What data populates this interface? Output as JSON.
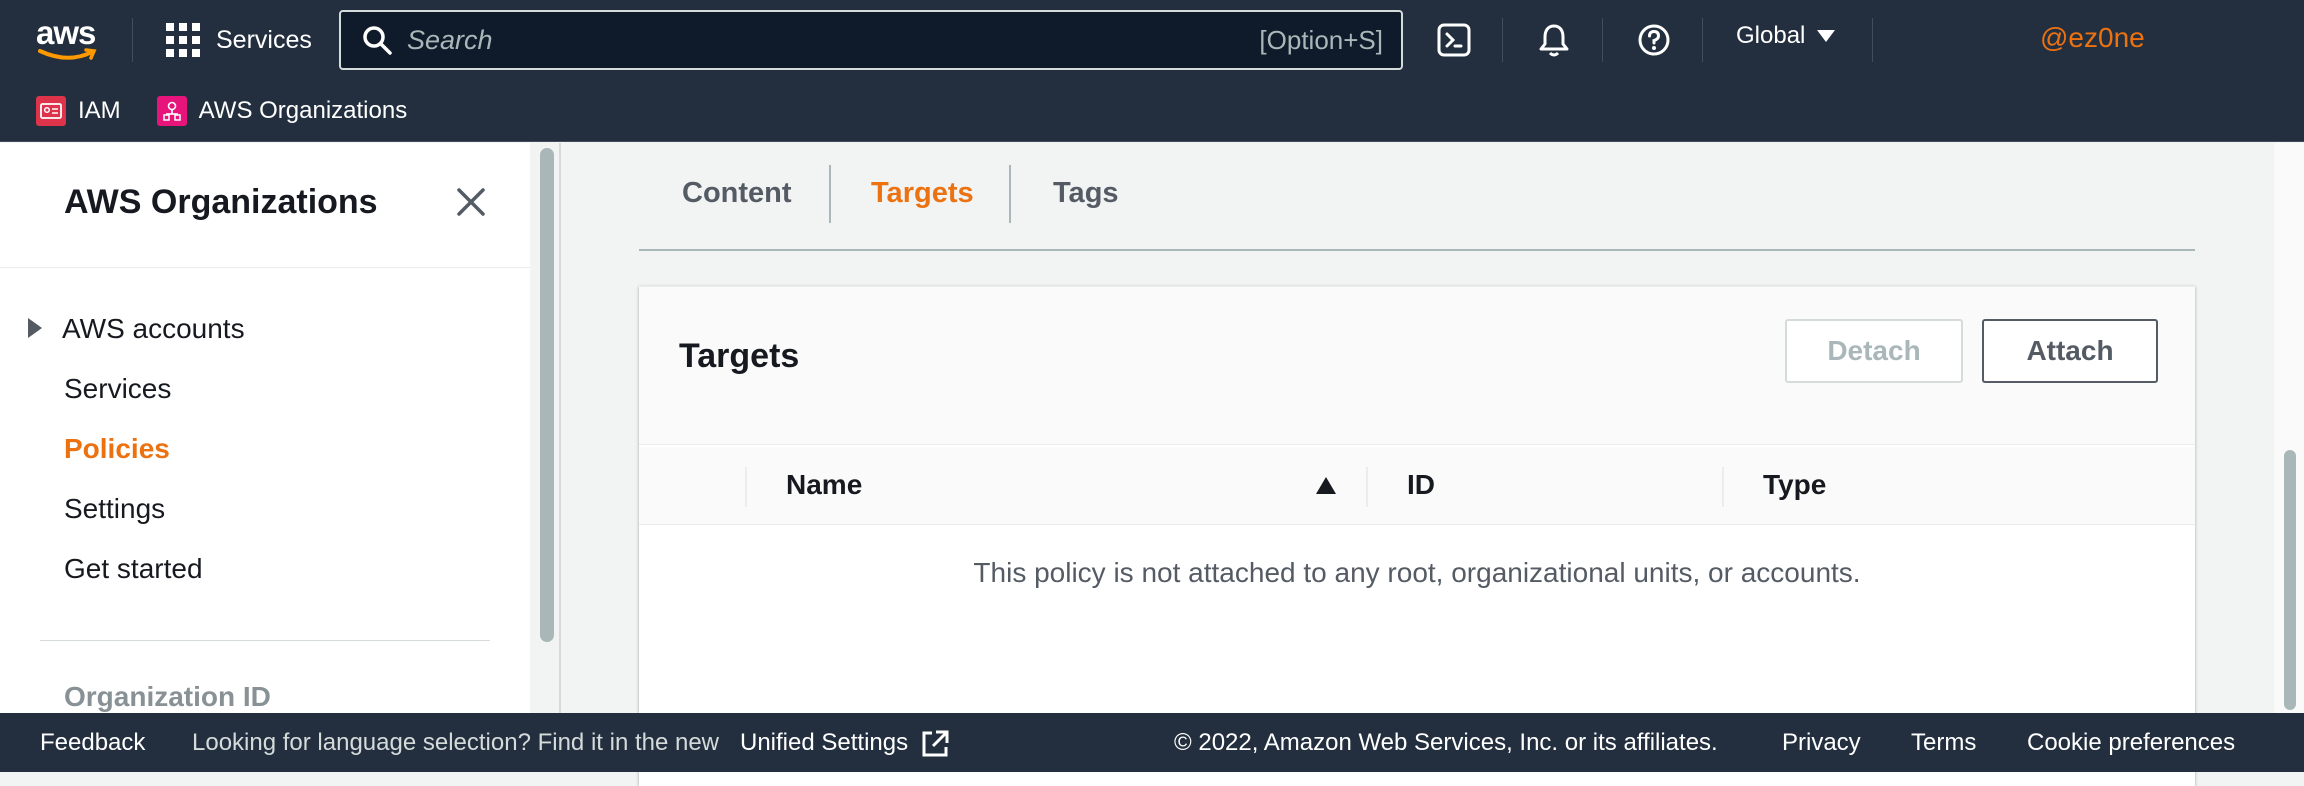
{
  "topbar": {
    "logo_text": "aws",
    "services_label": "Services",
    "search_placeholder": "Search",
    "search_shortcut": "[Option+S]",
    "region_label": "Global",
    "account_label": "@ez0ne",
    "icons": [
      "cloudshell-icon",
      "bell-icon",
      "help-icon"
    ]
  },
  "favorites": [
    {
      "label": "IAM",
      "color": "#dd344c"
    },
    {
      "label": "AWS Organizations",
      "color": "#e7157b"
    }
  ],
  "sidebar": {
    "title": "AWS Organizations",
    "items": [
      {
        "label": "AWS accounts",
        "expandable": true,
        "active": false
      },
      {
        "label": "Services",
        "active": false
      },
      {
        "label": "Policies",
        "active": true
      },
      {
        "label": "Settings",
        "active": false
      },
      {
        "label": "Get started",
        "active": false
      }
    ],
    "org_id_label": "Organization ID"
  },
  "tabs": [
    {
      "label": "Content",
      "active": false
    },
    {
      "label": "Targets",
      "active": true
    },
    {
      "label": "Tags",
      "active": false
    }
  ],
  "panel": {
    "title": "Targets",
    "detach_label": "Detach",
    "attach_label": "Attach",
    "columns": [
      "Name",
      "ID",
      "Type"
    ],
    "empty_message": "This policy is not attached to any root, organizational units, or accounts."
  },
  "footer": {
    "feedback": "Feedback",
    "language_note": "Looking for language selection? Find it in the new",
    "unified_settings": "Unified Settings",
    "copyright": "© 2022, Amazon Web Services, Inc. or its affiliates.",
    "privacy": "Privacy",
    "terms": "Terms",
    "cookies": "Cookie preferences"
  },
  "colors": {
    "header_bg": "#232f3e",
    "accent": "#ec7211"
  }
}
